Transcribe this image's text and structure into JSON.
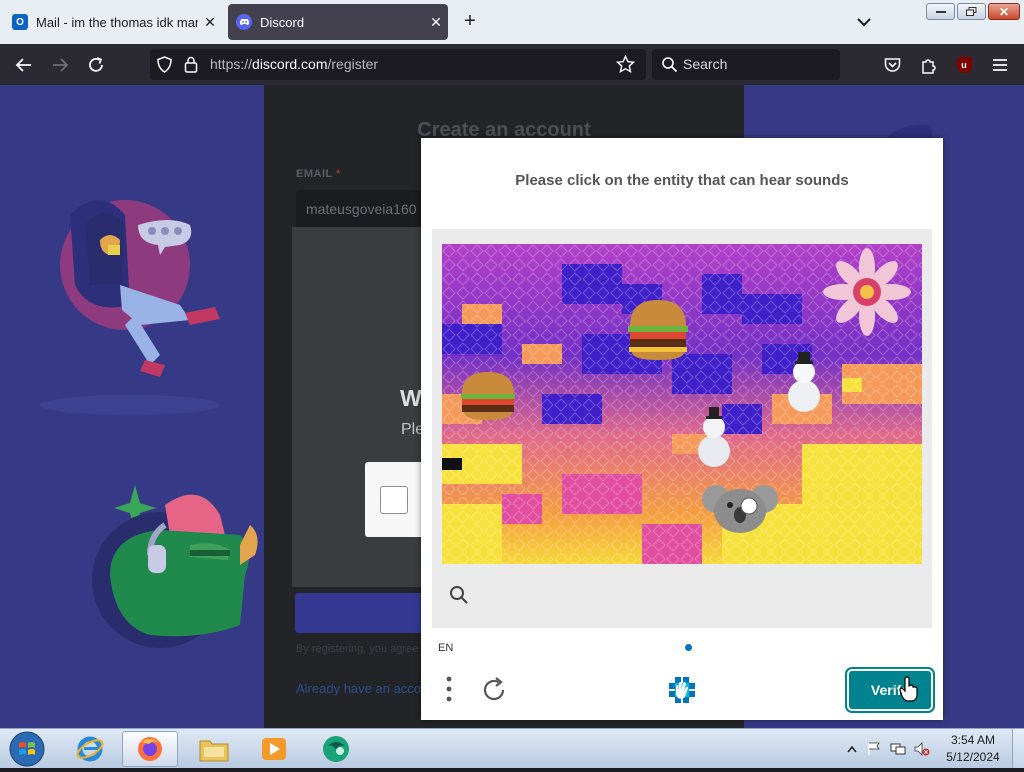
{
  "browser": {
    "tabs": [
      {
        "title": "Mail - im the thomas idk man -",
        "icon": "outlook-icon",
        "active": false
      },
      {
        "title": "Discord",
        "icon": "discord-icon",
        "active": true
      }
    ],
    "url_prefix": "https://",
    "url_domain": "discord.com",
    "url_path": "/register",
    "search_placeholder": "Search",
    "extension_badge": "u",
    "colors": {
      "toolbar": "#2b2a33",
      "urlbar": "#1c1b22",
      "tabstrip": "#e9eef5"
    }
  },
  "discord": {
    "title": "Create an account",
    "email_label": "EMAIL",
    "email_required": "*",
    "email_value": "mateusgoveia160",
    "partial_heading": "W",
    "partial_text": "Ple",
    "register_text": "By registering, you agree",
    "login_link": "Already have an acco",
    "colors": {
      "background": "#363a86",
      "modal": "#232428",
      "button": "#333991"
    }
  },
  "hcaptcha": {
    "prompt": "Please click on the entity that can hear sounds",
    "language": "EN",
    "verify_label": "Verify",
    "entities": [
      "flower",
      "burger",
      "burger",
      "snowman",
      "snowman",
      "koala"
    ],
    "colors": {
      "verify": "#00838f",
      "dot": "#0074bf"
    }
  },
  "taskbar": {
    "apps": [
      "internet-explorer",
      "firefox",
      "file-explorer",
      "media-player",
      "app"
    ],
    "time": "3:54 AM",
    "date": "5/12/2024"
  }
}
